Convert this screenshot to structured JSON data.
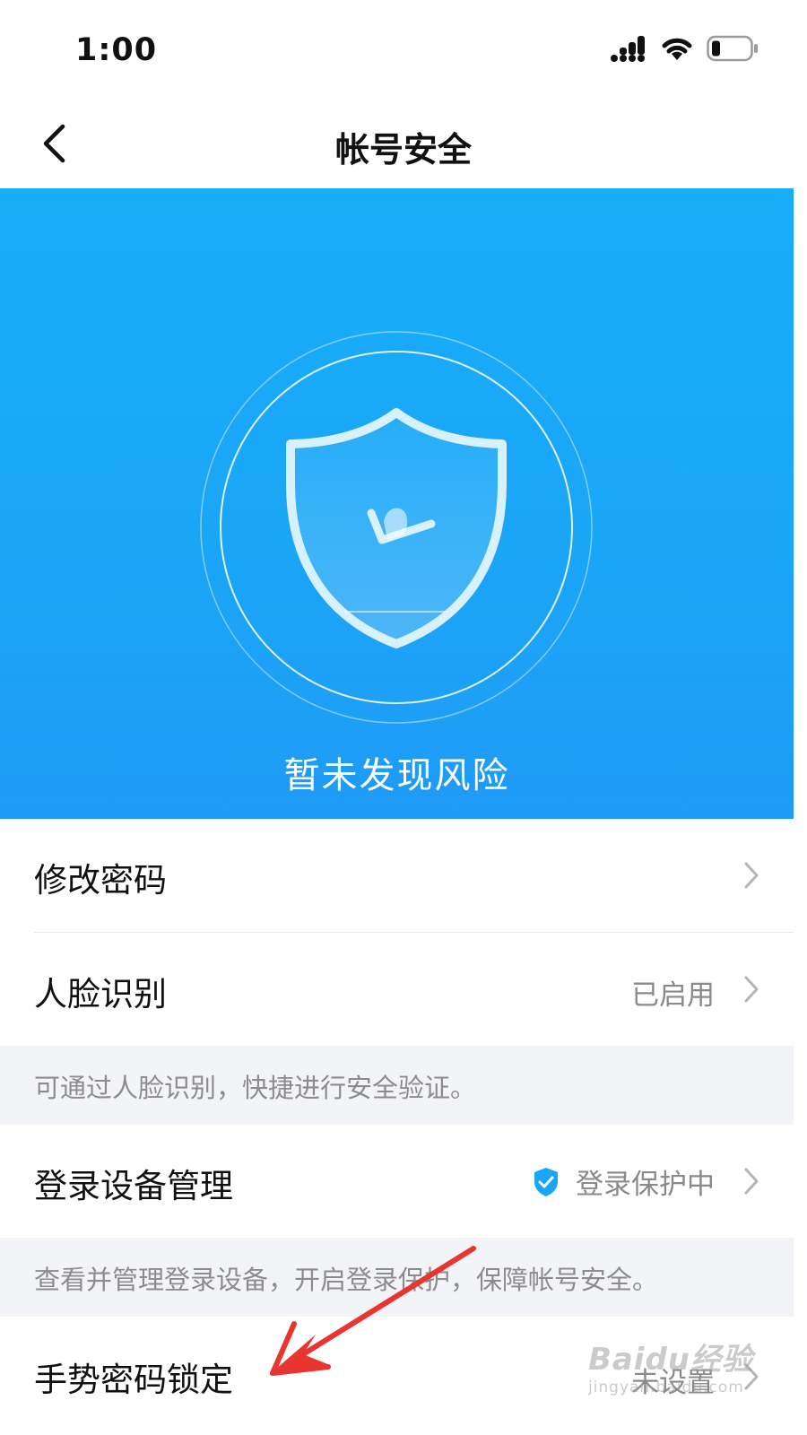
{
  "status_bar": {
    "time": "1:00",
    "signal_icon": "signal-bars-icon",
    "wifi_icon": "wifi-icon",
    "battery_icon": "battery-icon"
  },
  "nav": {
    "title": "帐号安全",
    "back_icon": "chevron-left-icon"
  },
  "hero": {
    "status_text": "暂未发现风险",
    "icon": "shield-check-icon",
    "background": "#17aef8"
  },
  "rows": [
    {
      "label": "修改密码",
      "value": ""
    },
    {
      "label": "人脸识别",
      "value": "已启用"
    },
    {
      "label": "登录设备管理",
      "value": "登录保护中"
    },
    {
      "label": "手势密码锁定",
      "value": "未设置"
    }
  ],
  "hints": {
    "face": "可通过人脸识别，快捷进行安全验证。",
    "device": "查看并管理登录设备，开启登录保护，保障帐号安全。"
  },
  "watermark": {
    "main": "Baidu经验",
    "sub": "jingyan.baidu.com"
  },
  "colors": {
    "accent": "#1aa6f7",
    "annotation_arrow": "#e8352f"
  }
}
